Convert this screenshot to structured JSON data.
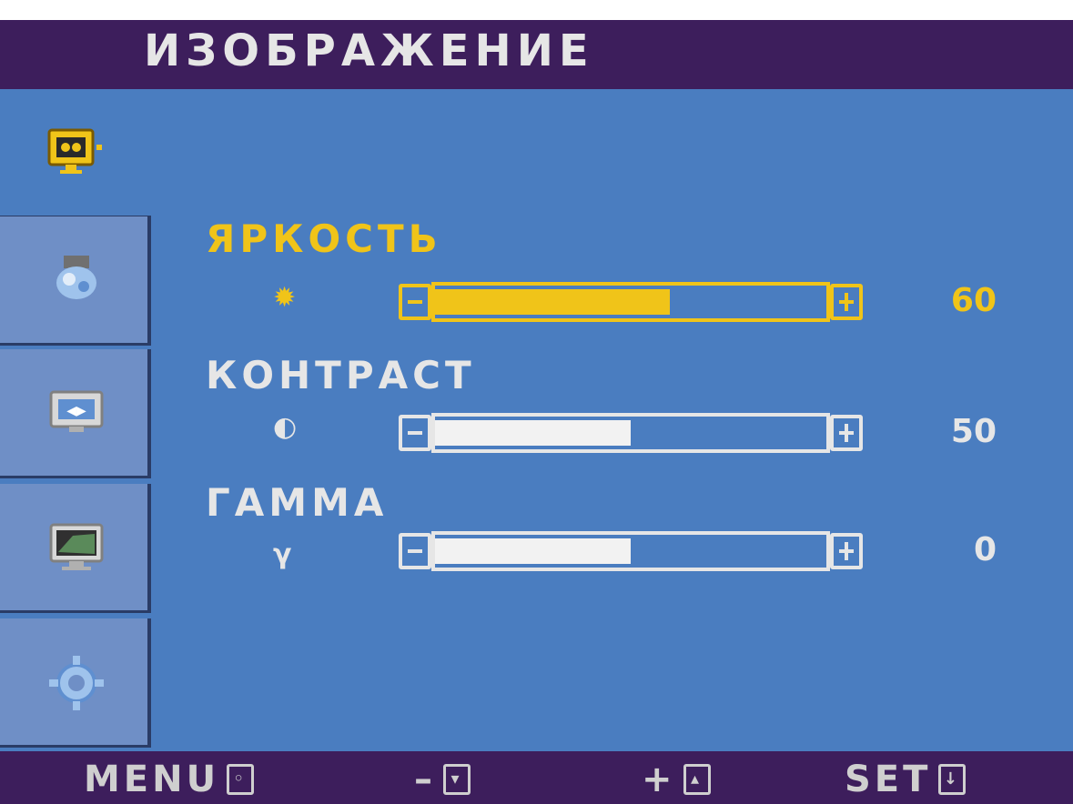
{
  "title": "ИЗОБРАЖЕНИЕ",
  "sidebar": {
    "items": [
      {
        "icon": "picture-monitor-icon",
        "active": true
      },
      {
        "icon": "color-icon",
        "active": false
      },
      {
        "icon": "position-icon",
        "active": false
      },
      {
        "icon": "tracking-icon",
        "active": false
      },
      {
        "icon": "setup-gear-icon",
        "active": false
      }
    ]
  },
  "settings": [
    {
      "label": "ЯРКОСТЬ",
      "icon": "brightness-sun-icon",
      "glyph": "✹",
      "value": "60",
      "level": 0.6,
      "selected": true
    },
    {
      "label": "КОНТРАСТ",
      "icon": "contrast-icon",
      "glyph": "◐",
      "value": "50",
      "level": 0.5,
      "selected": false
    },
    {
      "label": "ГАММА",
      "icon": "gamma-icon",
      "glyph": "γ",
      "value": "0",
      "level": 0.5,
      "selected": false
    }
  ],
  "bottom": {
    "menu_label": "MENU",
    "minus_label": "–",
    "plus_label": "+",
    "set_label": "SET"
  },
  "colors": {
    "background": "#4a7dc0",
    "bars": "#3d1e5c",
    "highlight": "#f0c419",
    "text": "#e6e6e6"
  }
}
